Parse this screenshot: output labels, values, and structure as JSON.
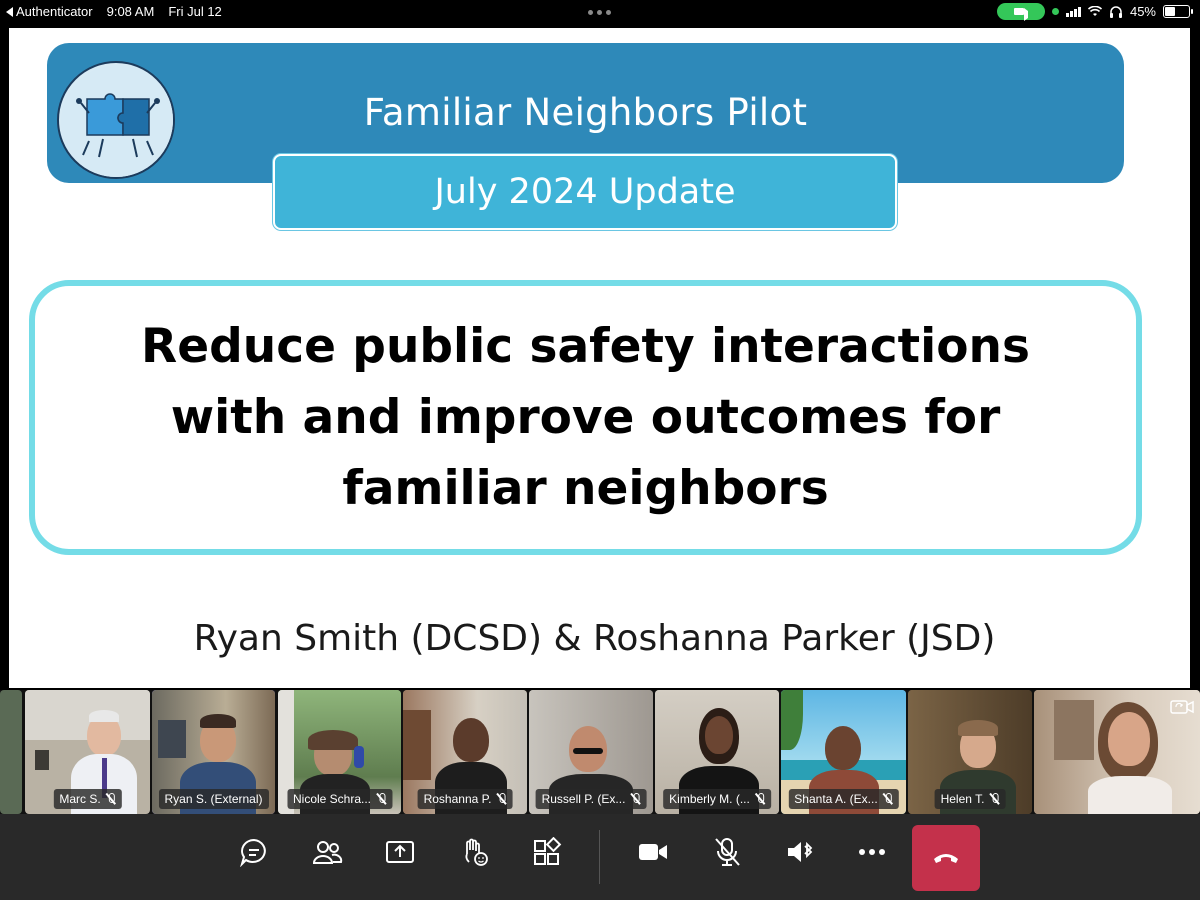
{
  "status_bar": {
    "back_app": "Authenticator",
    "time": "9:08 AM",
    "date": "Fri Jul 12",
    "battery": "45%"
  },
  "slide": {
    "title": "Familiar Neighbors Pilot",
    "subtitle": "July 2024 Update",
    "goal": "Reduce public safety interactions with and improve outcomes for familiar neighbors",
    "presenters": "Ryan Smith (DCSD) & Roshanna Parker (JSD)"
  },
  "participants": [
    {
      "name": "Marc S.",
      "muted": true
    },
    {
      "name": "Ryan S. (External)",
      "muted": false,
      "active": true
    },
    {
      "name": "Nicole Schra...",
      "muted": true
    },
    {
      "name": "Roshanna P.",
      "muted": true
    },
    {
      "name": "Russell P. (Ex...",
      "muted": true
    },
    {
      "name": "Kimberly M. (...",
      "muted": true
    },
    {
      "name": "Shanta A. (Ex...",
      "muted": true
    },
    {
      "name": "Helen T.",
      "muted": true
    },
    {
      "name": "",
      "muted": false
    }
  ],
  "toolbar": {
    "buttons": [
      "chat-icon",
      "people-icon",
      "share-screen-icon",
      "raise-hand-icon",
      "apps-icon",
      "camera-icon",
      "mic-off-icon",
      "speaker-icon",
      "more-icon"
    ],
    "hangup": "hangup-icon"
  },
  "colors": {
    "banner": "#2e89b9",
    "subtitle_box": "#3fb4d8",
    "goal_border": "#74dce7",
    "hangup": "#c4314b",
    "active_speaker": "#6c6de6"
  }
}
